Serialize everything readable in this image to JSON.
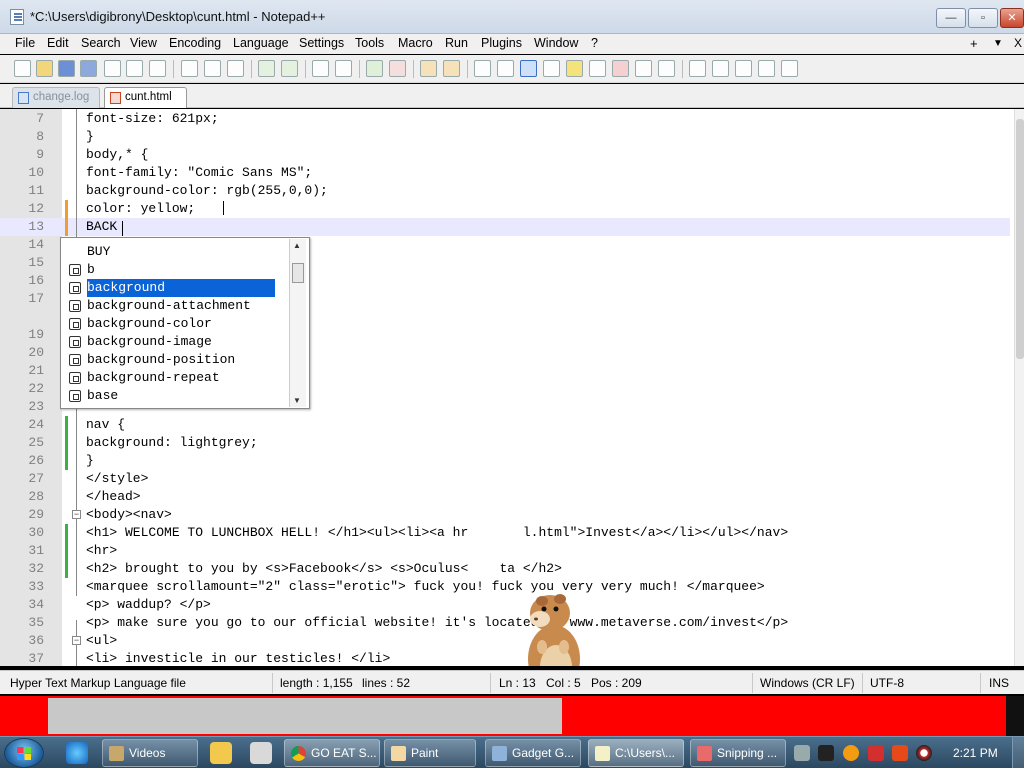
{
  "window": {
    "title": "*C:\\Users\\digibrony\\Desktop\\cunt.html - Notepad++",
    "controls": {
      "minimize": "—",
      "maximize": "▫",
      "close": "✕"
    }
  },
  "menu": {
    "items": [
      "File",
      "Edit",
      "Search",
      "View",
      "Encoding",
      "Language",
      "Settings",
      "Tools",
      "Macro",
      "Run",
      "Plugins",
      "Window",
      "?"
    ],
    "extra_plus": "+",
    "extra_down": "▼",
    "extra_close": "X"
  },
  "tabs": [
    {
      "label": "change.log",
      "close": "✕",
      "active": false
    },
    {
      "label": "cunt.html",
      "close": "✕",
      "active": true
    }
  ],
  "editor": {
    "lines": [
      {
        "n": "7",
        "text": "font-size: 621px;"
      },
      {
        "n": "8",
        "text": "}"
      },
      {
        "n": "9",
        "text": "body,* {"
      },
      {
        "n": "10",
        "text": "font-family: \"Comic Sans MS\";"
      },
      {
        "n": "11",
        "text": "background-color: rgb(255,0,0);"
      },
      {
        "n": "12",
        "text": "color: yellow;"
      },
      {
        "n": "13",
        "text": "BACK"
      },
      {
        "n": "14",
        "text": ""
      },
      {
        "n": "15",
        "text": ""
      },
      {
        "n": "16",
        "text": ""
      },
      {
        "n": "17",
        "text": ""
      },
      {
        "n": "19",
        "text": ""
      },
      {
        "n": "20",
        "text": ""
      },
      {
        "n": "21",
        "text": ""
      },
      {
        "n": "22",
        "text": ""
      },
      {
        "n": "23",
        "text": ""
      },
      {
        "n": "24",
        "text": "nav {"
      },
      {
        "n": "25",
        "text": "background: lightgrey;"
      },
      {
        "n": "26",
        "text": "}"
      },
      {
        "n": "27",
        "text": "</style>"
      },
      {
        "n": "28",
        "text": "</head>"
      },
      {
        "n": "29",
        "text": "<body><nav>"
      },
      {
        "n": "30",
        "text": "<h1> WELCOME TO LUNCHBOX HELL! </h1><ul><li><a hr       l.html\">Invest</a></li></ul></nav>"
      },
      {
        "n": "31",
        "text": "<hr>"
      },
      {
        "n": "32",
        "text": "<h2> brought to you by <s>Facebook</s> <s>Oculus<    ta </h2>"
      },
      {
        "n": "33",
        "text": "<marquee scrollamount=\"2\" class=\"erotic\"> fuck you! fuck you very very much! </marquee>"
      },
      {
        "n": "34",
        "text": "<p> waddup? </p>"
      },
      {
        "n": "35",
        "text": "<p> make sure you go to our official website! it's located at www.metaverse.com/invest</p>"
      },
      {
        "n": "36",
        "text": "<ul>"
      },
      {
        "n": "37",
        "text": "<li> investicle in our testicles! </li>"
      }
    ]
  },
  "autocomplete": {
    "items": [
      {
        "label": "BUY",
        "icon": false,
        "selected": false
      },
      {
        "label": "b",
        "icon": true,
        "selected": false
      },
      {
        "label": "background",
        "icon": true,
        "selected": true
      },
      {
        "label": "background-attachment",
        "icon": true,
        "selected": false
      },
      {
        "label": "background-color",
        "icon": true,
        "selected": false
      },
      {
        "label": "background-image",
        "icon": true,
        "selected": false
      },
      {
        "label": "background-position",
        "icon": true,
        "selected": false
      },
      {
        "label": "background-repeat",
        "icon": true,
        "selected": false
      },
      {
        "label": "base",
        "icon": true,
        "selected": false
      }
    ],
    "scroll_up": "▲",
    "scroll_down": "▼"
  },
  "status": {
    "filetype": "Hyper Text Markup Language file",
    "length": "length : 1,155",
    "lines": "lines : 52",
    "ln": "Ln : 13",
    "col": "Col : 5",
    "pos": "Pos : 209",
    "eol": "Windows (CR LF)",
    "encoding": "UTF-8",
    "mode": "INS"
  },
  "taskbar": {
    "tasks": [
      "Videos",
      "GO EAT S...",
      "Paint",
      "Gadget G...",
      "C:\\Users\\...",
      "Snipping ..."
    ],
    "clock": "2:21 PM"
  },
  "colors": {
    "selection": "#0a64d8",
    "current_line": "#e8e8ff",
    "change_orange": "#f39c2c",
    "change_green": "#3cb043",
    "red_strip": "#ff0000"
  },
  "icons": {
    "app": "notepad-icon",
    "autocomplete_item": "keyword-cube-icon",
    "hamster": "hamster-image"
  }
}
